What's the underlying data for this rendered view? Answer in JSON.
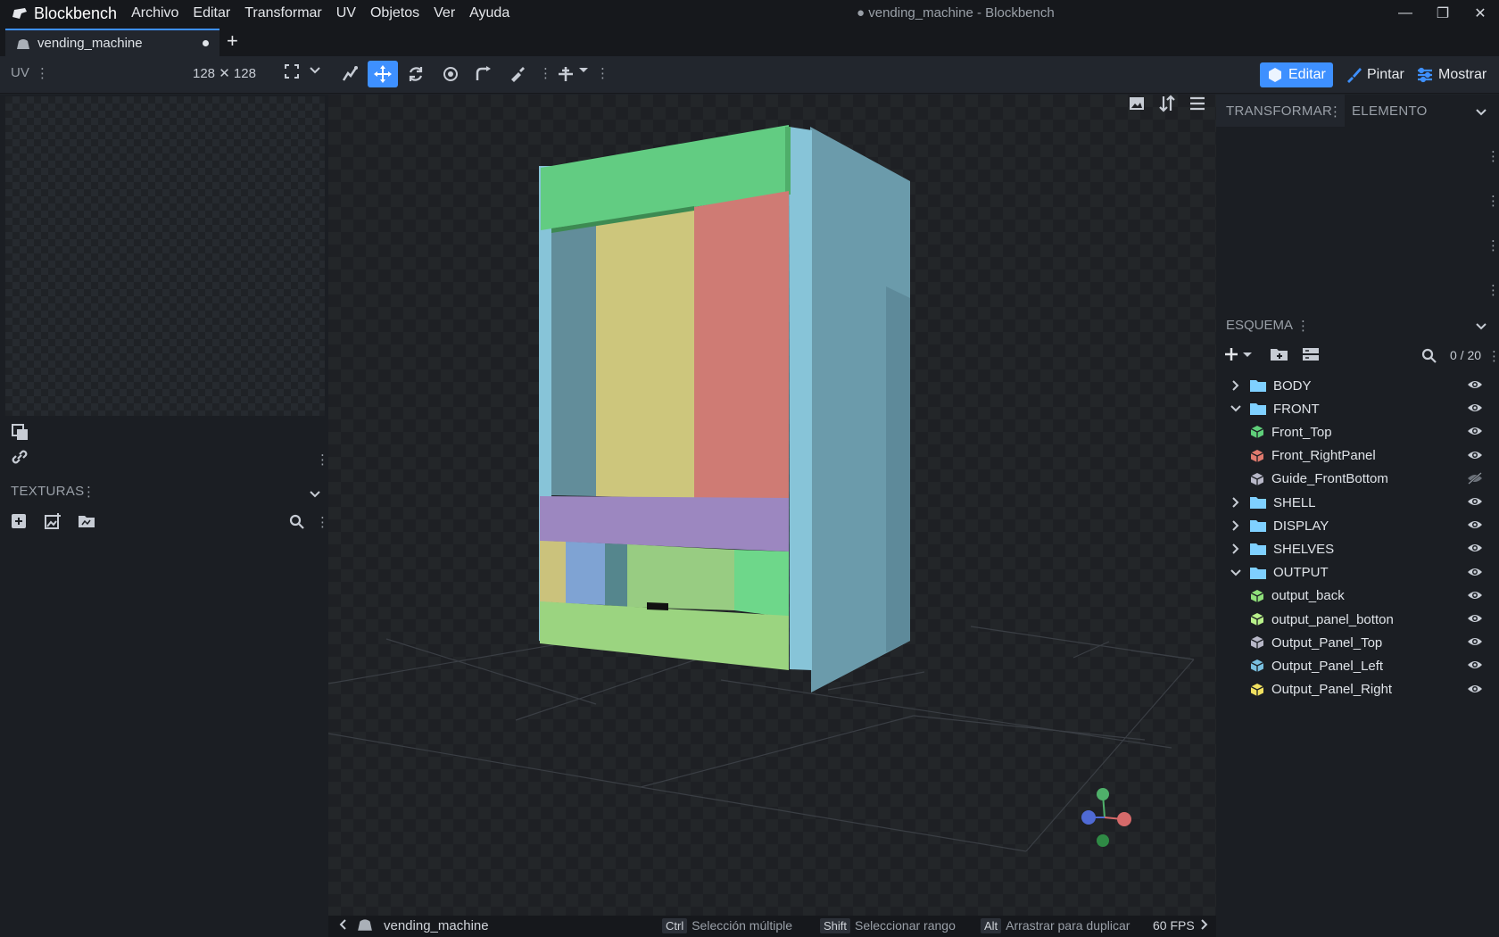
{
  "app": {
    "name": "Blockbench",
    "window_title": "● vending_machine - Blockbench"
  },
  "menu": [
    "Archivo",
    "Editar",
    "Transformar",
    "UV",
    "Objetos",
    "Ver",
    "Ayuda"
  ],
  "tab": {
    "label": "vending_machine"
  },
  "toolbar": {
    "uv_label": "UV",
    "uv_size": "128 ✕ 128",
    "modes": {
      "edit": "Editar",
      "paint": "Pintar",
      "display": "Mostrar"
    }
  },
  "left": {
    "textures_label": "TEXTURAS"
  },
  "right": {
    "tabs": {
      "transform": "TRANSFORMAR",
      "element": "ELEMENTO"
    },
    "outliner_label": "ESQUEMA",
    "count": "0 / 20",
    "items": [
      {
        "label": "BODY",
        "kind": "folder",
        "open": false,
        "indent": 0,
        "visible": true
      },
      {
        "label": "FRONT",
        "kind": "folder",
        "open": true,
        "indent": 0,
        "visible": true
      },
      {
        "label": "Front_Top",
        "kind": "cube",
        "color": "#5fd07a",
        "indent": 1,
        "visible": true
      },
      {
        "label": "Front_RightPanel",
        "kind": "cube",
        "color": "#e07a6e",
        "indent": 1,
        "visible": true
      },
      {
        "label": "Guide_FrontBottom",
        "kind": "cube",
        "color": "#b8b8c8",
        "indent": 1,
        "visible": false
      },
      {
        "label": "SHELL",
        "kind": "folder",
        "open": false,
        "indent": 0,
        "visible": true
      },
      {
        "label": "DISPLAY",
        "kind": "folder",
        "open": false,
        "indent": 0,
        "visible": true
      },
      {
        "label": "SHELVES",
        "kind": "folder",
        "open": false,
        "indent": 0,
        "visible": true
      },
      {
        "label": "OUTPUT",
        "kind": "folder",
        "open": true,
        "indent": 0,
        "visible": true
      },
      {
        "label": "output_back",
        "kind": "cube",
        "color": "#8fe07a",
        "indent": 1,
        "visible": true
      },
      {
        "label": "output_panel_botton",
        "kind": "cube",
        "color": "#b8f08a",
        "indent": 1,
        "visible": true
      },
      {
        "label": "Output_Panel_Top",
        "kind": "cube",
        "color": "#b8b8c8",
        "indent": 1,
        "visible": true
      },
      {
        "label": "Output_Panel_Left",
        "kind": "cube",
        "color": "#7ac0e0",
        "indent": 1,
        "visible": true
      },
      {
        "label": "Output_Panel_Right",
        "kind": "cube",
        "color": "#f0e060",
        "indent": 1,
        "visible": true
      }
    ]
  },
  "status": {
    "file": "vending_machine",
    "hints": [
      {
        "key": "Ctrl",
        "text": "Selección múltiple"
      },
      {
        "key": "Shift",
        "text": "Seleccionar rango"
      },
      {
        "key": "Alt",
        "text": "Arrastrar para duplicar"
      }
    ],
    "fps": "60 FPS"
  },
  "colors": {
    "accent": "#3e90ff",
    "panel_bg": "#1b1e23",
    "folder": "#7fd0ff"
  }
}
